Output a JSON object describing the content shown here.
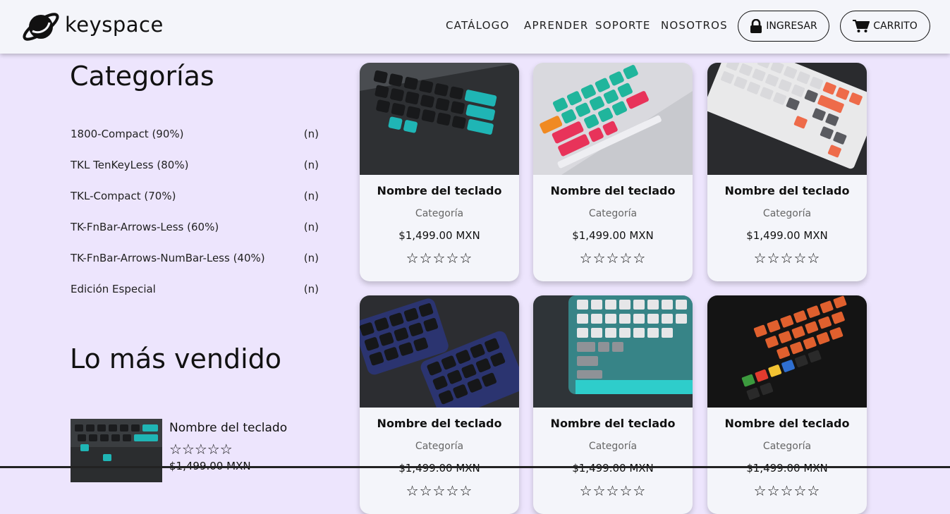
{
  "brand": {
    "name": "keyspace"
  },
  "nav": {
    "catalog": "CATÁLOGO",
    "learn": "APRENDER",
    "support": "SOPORTE",
    "about": "NOSOTROS"
  },
  "actions": {
    "login": "INGRESAR",
    "cart": "CARRITO"
  },
  "sidebar": {
    "categories_title": "Categorías",
    "categories": [
      {
        "label": "1800-Compact (90%)",
        "count": "(n)"
      },
      {
        "label": "TKL TenKeyLess (80%)",
        "count": "(n)"
      },
      {
        "label": "TKL-Compact (70%)",
        "count": "(n)"
      },
      {
        "label": "TK-FnBar-Arrows-Less (60%)",
        "count": "(n)"
      },
      {
        "label": "TK-FnBar-Arrows-NumBar-Less (40%)",
        "count": "(n)"
      },
      {
        "label": "Edición Especial",
        "count": "(n)"
      }
    ],
    "best_title": "Lo más vendido",
    "best_item": {
      "name": "Nombre del teclado",
      "stars": "☆☆☆☆☆",
      "price": "$1,499.00 MXN"
    }
  },
  "products": [
    {
      "name": "Nombre del teclado",
      "category": "Categoría",
      "price": "$1,499.00 MXN",
      "stars": "☆☆☆☆☆"
    },
    {
      "name": "Nombre del teclado",
      "category": "Categoría",
      "price": "$1,499.00 MXN",
      "stars": "☆☆☆☆☆"
    },
    {
      "name": "Nombre del teclado",
      "category": "Categoría",
      "price": "$1,499.00 MXN",
      "stars": "☆☆☆☆☆"
    },
    {
      "name": "Nombre del teclado",
      "category": "Categoría",
      "price": "$1,499.00 MXN",
      "stars": "☆☆☆☆☆"
    },
    {
      "name": "Nombre del teclado",
      "category": "Categoría",
      "price": "$1,499.00 MXN",
      "stars": "☆☆☆☆☆"
    },
    {
      "name": "Nombre del teclado",
      "category": "Categoría",
      "price": "$1,499.00 MXN",
      "stars": "☆☆☆☆☆"
    }
  ],
  "icons": {
    "logo": "planet-logo-icon",
    "login": "lock-icon",
    "cart": "cart-icon",
    "rating": "star-outline-icon"
  },
  "colors": {
    "background": "#ede5fd",
    "header": "#f4f5fa",
    "card": "#f4f5fa",
    "accent_teal": "#1fb5b5"
  }
}
